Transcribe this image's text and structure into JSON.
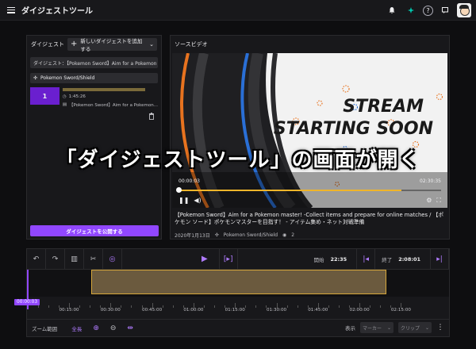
{
  "app": {
    "title": "ダイジェストツール"
  },
  "left_panel": {
    "title": "ダイジェスト",
    "add_button": "新しいダイジェストを追加する",
    "digest_title": "ダイジェスト：【Pokemon Sword】Aim for a Pokemon m",
    "category": "Pokemon Sword/Shield",
    "clip": {
      "index": "1",
      "duration": "1:45:26",
      "title": "【Pokemon Sword】Aim for a Pokemon...",
      "progress": 0.85
    },
    "publish_button": "ダイジェストを公開する"
  },
  "video_panel": {
    "title": "ソースビデオ",
    "stream_line1": "STREAM",
    "stream_line2": "STARTING SOON",
    "time_current": "00:00:03",
    "time_total": "02:30:35",
    "progress": 0.85,
    "video_title": "【Pokemon Sword】Aim for a Pokemon master! -Collect items and prepare for online matches / 【ポケモン ソード】ポケモンマスターを目指す！ - アイテム集め・ネット対戦準備",
    "date": "2020年1月13日",
    "game": "Pokemon Sword/Shield",
    "viewers": "2"
  },
  "overlay": {
    "caption": "「ダイジェストツール」の画面が開く"
  },
  "timeline": {
    "start_label": "開始",
    "start_value": "22:35",
    "end_label": "終了",
    "end_value": "2:08:01",
    "playhead_time": "00:00:03",
    "ticks": [
      "00:15:00",
      "00:30:00",
      "00:45:00",
      "01:00:00",
      "01:15:00",
      "01:30:00",
      "01:45:00",
      "02:00:00",
      "02:15:00"
    ],
    "zoom_label": "ズーム範囲",
    "zoom_value": "全長",
    "display_label": "表示",
    "marker_select": "マーカー",
    "clip_select": "クリップ"
  },
  "colors": {
    "accent": "#9147ff",
    "clip": "#6b5a3e",
    "clip_border": "#d6a63a"
  }
}
